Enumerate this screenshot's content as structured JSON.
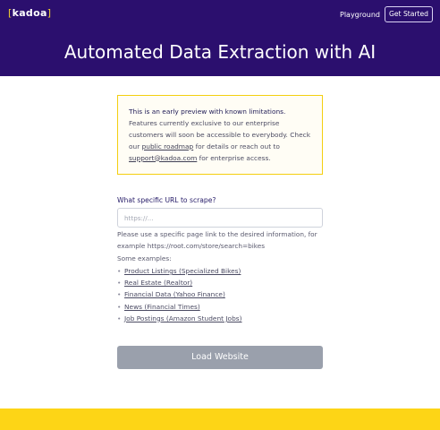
{
  "header": {
    "logo": {
      "bracket_open": "[",
      "text": "kadoa",
      "bracket_close": "]"
    },
    "nav": {
      "playground_label": "Playground",
      "cta_label": "Get Started"
    },
    "title": "Automated Data Extraction with AI"
  },
  "notice": {
    "title": "This is an early preview with known limitations.",
    "body_1": "Features currently exclusive to our enterprise customers will soon be accessible to everybody. Check our ",
    "roadmap_link": "public roadmap",
    "body_2": " for details or reach out to ",
    "email_link": "support@kadoa.com",
    "body_3": " for enterprise access."
  },
  "form": {
    "url_label": "What specific URL to scrape?",
    "url_placeholder": "https://...",
    "url_value": "",
    "help_text": "Please use a specific page link to the desired information, for example https://root.com/store/search=bikes",
    "examples_label": "Some examples:",
    "bullet": "•",
    "examples": [
      {
        "label": "Product Listings (Specialized Bikes)"
      },
      {
        "label": "Real Estate (Realtor)"
      },
      {
        "label": "Financial Data (Yahoo Finance)"
      },
      {
        "label": "News (Financial Times)"
      },
      {
        "label": "Job Postings (Amazon Student Jobs)"
      }
    ],
    "submit_label": "Load Website"
  },
  "colors": {
    "header_bg": "#2b0f6e",
    "accent_yellow": "#fdd516",
    "button_disabled": "#9aa0ac"
  }
}
